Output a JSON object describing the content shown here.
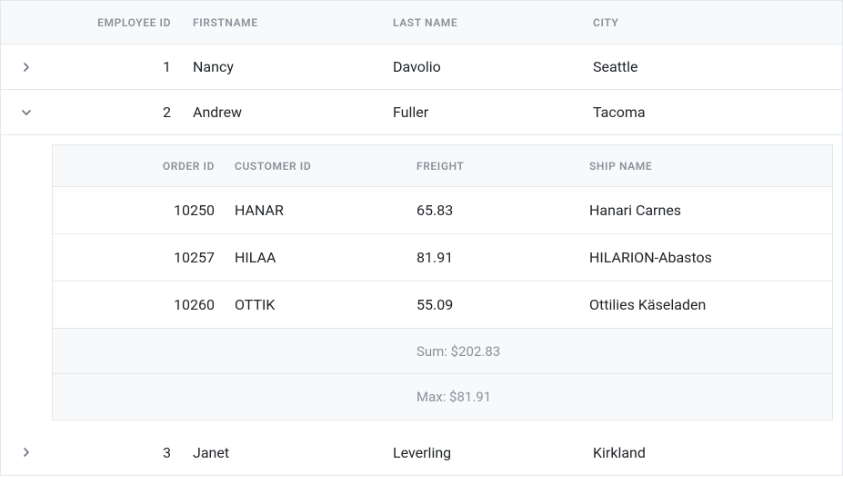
{
  "outer": {
    "headers": {
      "employee_id": "EMPLOYEE ID",
      "first_name": "FIRSTNAME",
      "last_name": "LAST NAME",
      "city": "CITY"
    },
    "rows": [
      {
        "expanded": false,
        "employee_id": "1",
        "first_name": "Nancy",
        "last_name": "Davolio",
        "city": "Seattle"
      },
      {
        "expanded": true,
        "employee_id": "2",
        "first_name": "Andrew",
        "last_name": "Fuller",
        "city": "Tacoma"
      },
      {
        "expanded": false,
        "employee_id": "3",
        "first_name": "Janet",
        "last_name": "Leverling",
        "city": "Kirkland"
      }
    ]
  },
  "detail": {
    "headers": {
      "order_id": "ORDER ID",
      "customer_id": "CUSTOMER ID",
      "freight": "FREIGHT",
      "ship_name": "SHIP NAME"
    },
    "rows": [
      {
        "order_id": "10250",
        "customer_id": "HANAR",
        "freight": "65.83",
        "ship_name": "Hanari Carnes"
      },
      {
        "order_id": "10257",
        "customer_id": "HILAA",
        "freight": "81.91",
        "ship_name": "HILARION-Abastos"
      },
      {
        "order_id": "10260",
        "customer_id": "OTTIK",
        "freight": "55.09",
        "ship_name": "Ottilies Käseladen"
      }
    ],
    "summary": {
      "sum": "Sum: $202.83",
      "max": "Max: $81.91"
    }
  }
}
